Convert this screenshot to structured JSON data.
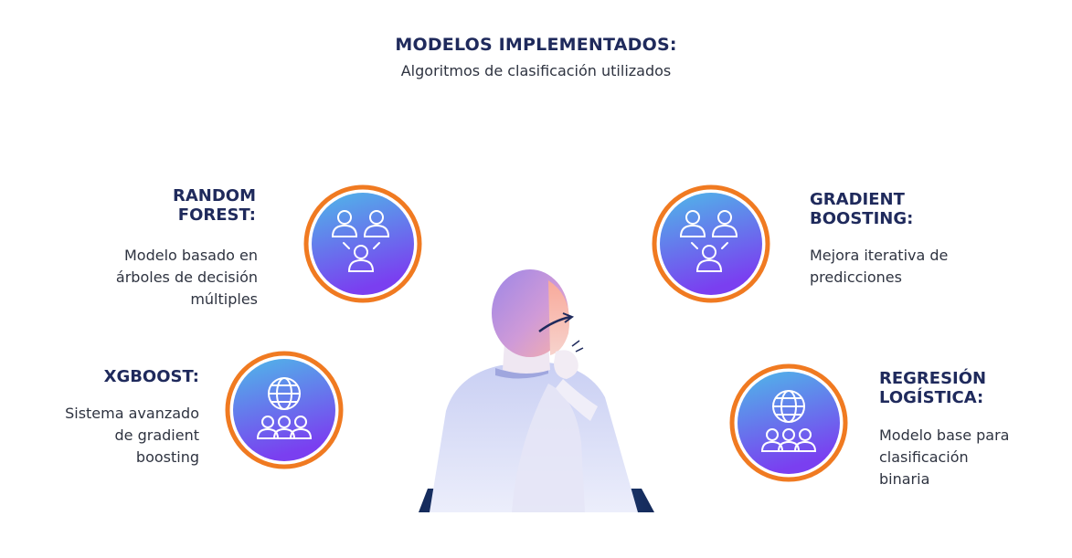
{
  "header": {
    "title": "MODELOS IMPLEMENTADOS:",
    "subtitle": "Algoritmos de clasificación utilizados"
  },
  "items": [
    {
      "title": "RANDOM\nFOREST:",
      "description": "Modelo basado en\nárboles de decisión\nmúltiples",
      "icon": "team-network-icon"
    },
    {
      "title": "GRADIENT\nBOOSTING:",
      "description": "Mejora iterativa de\npredicciones",
      "icon": "team-network-icon"
    },
    {
      "title": "XGBOOST:",
      "description": "Sistema avanzado\nde gradient\nboosting",
      "icon": "globe-people-icon"
    },
    {
      "title": "REGRESIÓN\nLOGÍSTICA:",
      "description": "Modelo base para\nclasificación\nbinaria",
      "icon": "globe-people-icon"
    }
  ],
  "colors": {
    "title": "#1f2a5c",
    "ring": "#f07a21",
    "gradient_top": "#4fb8e8",
    "gradient_bottom": "#7a3ff0"
  }
}
